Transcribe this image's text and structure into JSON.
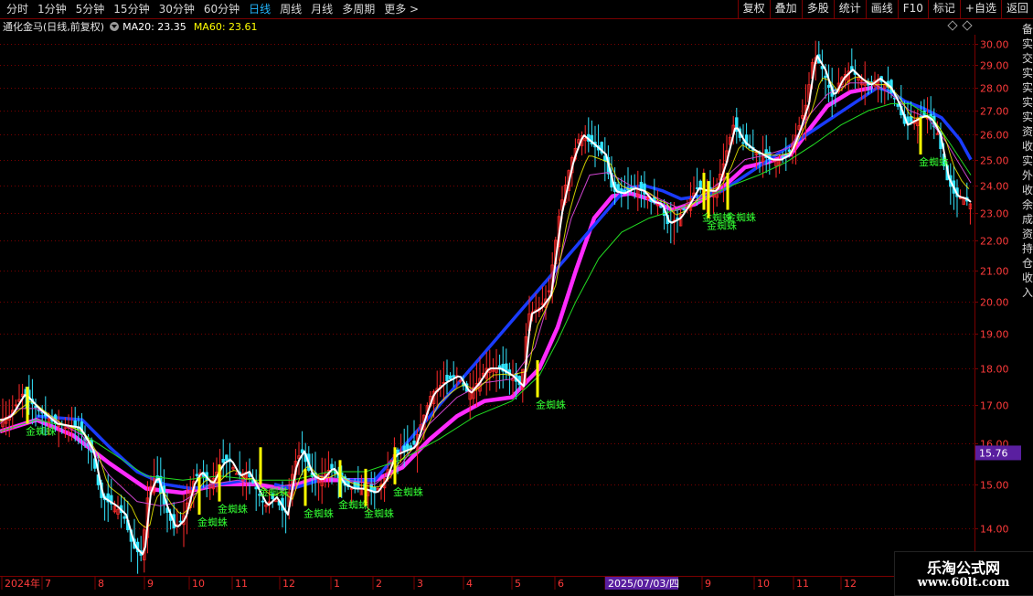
{
  "toolbar": {
    "periods": [
      "分时",
      "1分钟",
      "5分钟",
      "15分钟",
      "30分钟",
      "60分钟",
      "日线",
      "周线",
      "月线",
      "多周期",
      "更多"
    ],
    "active_period": "日线",
    "more_suffix": ">",
    "buttons": [
      "复权",
      "叠加",
      "多股",
      "统计",
      "画线",
      "F10",
      "标记",
      "+自选",
      "返回"
    ]
  },
  "info": {
    "title": "通化金马(日线,前复权)",
    "ma20": "MA20: 23.35",
    "ma60": "MA60: 23.61"
  },
  "watermark": {
    "title": "乐淘公式网",
    "url": "www.60lt.com"
  },
  "side_text": "备实交实实实实资收实外收余成资持仓收入",
  "colors": {
    "background": "#000000",
    "grid": "#7a0000",
    "up": "#ff2a2a",
    "down": "#33e6ff",
    "ma_white": "#ffffff",
    "ma_yellow": "#ffff00",
    "band_magenta": "#ff2bff",
    "band_blue": "#1a3cff",
    "ma_purple": "#cc44cc",
    "ma_green": "#22dd22",
    "signal_yellow": "#ffff00",
    "signal_label": "#33ff33",
    "current_price_bg": "#5a1fa0"
  },
  "chart_data": {
    "type": "candlestick",
    "title": "",
    "y_axis": {
      "ticks": [
        14.0,
        15.0,
        16.0,
        17.0,
        18.0,
        19.0,
        20.0,
        21.0,
        22.0,
        23.0,
        24.0,
        25.0,
        26.0,
        27.0,
        28.0,
        29.0,
        30.0
      ],
      "range": [
        13.0,
        30.2
      ],
      "side": "right",
      "scale": "log"
    },
    "current_price": "15.76",
    "x_axis": {
      "labels": [
        "2024年",
        "7",
        "8",
        "9",
        "10",
        "11",
        "12",
        "1",
        "2",
        "3",
        "4",
        "5",
        "6",
        "2025/07/03/四",
        "9",
        "10",
        "11",
        "12"
      ]
    },
    "price_path": [
      [
        0,
        16.6
      ],
      [
        10,
        16.7
      ],
      [
        25,
        17.3
      ],
      [
        40,
        16.9
      ],
      [
        60,
        16.5
      ],
      [
        85,
        16.4
      ],
      [
        100,
        15.8
      ],
      [
        110,
        14.7
      ],
      [
        125,
        14.5
      ],
      [
        135,
        14.3
      ],
      [
        145,
        13.6
      ],
      [
        155,
        13.4
      ],
      [
        162,
        14.8
      ],
      [
        170,
        15.2
      ],
      [
        180,
        14.5
      ],
      [
        190,
        14.0
      ],
      [
        200,
        14.2
      ],
      [
        210,
        15.0
      ],
      [
        218,
        15.3
      ],
      [
        230,
        15.0
      ],
      [
        242,
        15.5
      ],
      [
        250,
        15.6
      ],
      [
        260,
        15.2
      ],
      [
        270,
        15.3
      ],
      [
        280,
        14.9
      ],
      [
        290,
        14.5
      ],
      [
        300,
        14.7
      ],
      [
        312,
        14.3
      ],
      [
        322,
        15.5
      ],
      [
        330,
        15.8
      ],
      [
        340,
        15.2
      ],
      [
        350,
        15.1
      ],
      [
        362,
        15.4
      ],
      [
        375,
        15.0
      ],
      [
        385,
        14.9
      ],
      [
        395,
        14.9
      ],
      [
        410,
        14.8
      ],
      [
        420,
        15.1
      ],
      [
        430,
        15.7
      ],
      [
        440,
        15.8
      ],
      [
        452,
        15.9
      ],
      [
        462,
        16.6
      ],
      [
        472,
        17.3
      ],
      [
        485,
        17.6
      ],
      [
        500,
        17.8
      ],
      [
        512,
        17.3
      ],
      [
        522,
        17.6
      ],
      [
        532,
        18.0
      ],
      [
        545,
        18.0
      ],
      [
        558,
        17.8
      ],
      [
        570,
        17.5
      ],
      [
        578,
        19.6
      ],
      [
        590,
        19.8
      ],
      [
        600,
        20.2
      ],
      [
        612,
        23.0
      ],
      [
        625,
        25.0
      ],
      [
        635,
        26.0
      ],
      [
        648,
        25.6
      ],
      [
        660,
        25.2
      ],
      [
        670,
        23.8
      ],
      [
        680,
        23.7
      ],
      [
        692,
        23.9
      ],
      [
        702,
        23.8
      ],
      [
        712,
        23.4
      ],
      [
        722,
        23.3
      ],
      [
        730,
        22.6
      ],
      [
        742,
        22.8
      ],
      [
        752,
        23.3
      ],
      [
        762,
        23.9
      ],
      [
        772,
        23.8
      ],
      [
        782,
        23.8
      ],
      [
        792,
        24.9
      ],
      [
        802,
        26.4
      ],
      [
        812,
        25.7
      ],
      [
        822,
        25.4
      ],
      [
        832,
        25.2
      ],
      [
        842,
        25.0
      ],
      [
        852,
        25.0
      ],
      [
        862,
        25.2
      ],
      [
        872,
        26.1
      ],
      [
        882,
        27.3
      ],
      [
        890,
        29.5
      ],
      [
        900,
        28.8
      ],
      [
        910,
        27.6
      ],
      [
        920,
        28.4
      ],
      [
        930,
        28.8
      ],
      [
        940,
        28.4
      ],
      [
        950,
        28.1
      ],
      [
        960,
        28.4
      ],
      [
        972,
        28.0
      ],
      [
        980,
        27.4
      ],
      [
        990,
        26.4
      ],
      [
        1000,
        26.6
      ],
      [
        1010,
        26.8
      ],
      [
        1018,
        26.6
      ],
      [
        1026,
        26.0
      ],
      [
        1035,
        24.3
      ],
      [
        1045,
        23.6
      ],
      [
        1055,
        23.5
      ],
      [
        1062,
        23.3
      ]
    ],
    "series": [
      {
        "name": "MA20",
        "points": [
          [
            0,
            16.5
          ],
          [
            20,
            16.9
          ],
          [
            40,
            16.9
          ],
          [
            60,
            16.6
          ],
          [
            90,
            16.2
          ],
          [
            120,
            15.2
          ],
          [
            150,
            14.6
          ],
          [
            175,
            14.5
          ],
          [
            200,
            14.6
          ],
          [
            230,
            15.0
          ],
          [
            260,
            15.1
          ],
          [
            290,
            14.9
          ],
          [
            320,
            15.0
          ],
          [
            350,
            15.2
          ],
          [
            380,
            15.1
          ],
          [
            410,
            15.0
          ],
          [
            440,
            15.5
          ],
          [
            470,
            16.5
          ],
          [
            500,
            17.2
          ],
          [
            530,
            17.6
          ],
          [
            560,
            17.7
          ],
          [
            585,
            18.6
          ],
          [
            605,
            20.5
          ],
          [
            625,
            22.8
          ],
          [
            645,
            24.4
          ],
          [
            665,
            24.5
          ],
          [
            690,
            24.0
          ],
          [
            715,
            23.6
          ],
          [
            740,
            23.2
          ],
          [
            765,
            23.5
          ],
          [
            790,
            24.2
          ],
          [
            815,
            25.0
          ],
          [
            840,
            25.2
          ],
          [
            865,
            25.5
          ],
          [
            885,
            26.8
          ],
          [
            905,
            27.7
          ],
          [
            930,
            28.2
          ],
          [
            955,
            28.2
          ],
          [
            975,
            27.7
          ],
          [
            995,
            27.0
          ],
          [
            1015,
            26.7
          ],
          [
            1035,
            25.7
          ],
          [
            1062,
            24.1
          ]
        ]
      },
      {
        "name": "MA60",
        "points": [
          [
            0,
            16.3
          ],
          [
            40,
            16.6
          ],
          [
            80,
            16.4
          ],
          [
            120,
            15.8
          ],
          [
            160,
            15.2
          ],
          [
            200,
            15.1
          ],
          [
            240,
            15.2
          ],
          [
            280,
            15.1
          ],
          [
            320,
            15.1
          ],
          [
            360,
            15.3
          ],
          [
            400,
            15.3
          ],
          [
            440,
            15.6
          ],
          [
            480,
            16.1
          ],
          [
            520,
            16.7
          ],
          [
            560,
            17.1
          ],
          [
            590,
            17.8
          ],
          [
            610,
            18.8
          ],
          [
            630,
            20.0
          ],
          [
            655,
            21.4
          ],
          [
            680,
            22.3
          ],
          [
            710,
            22.8
          ],
          [
            740,
            23.1
          ],
          [
            770,
            23.5
          ],
          [
            800,
            24.0
          ],
          [
            830,
            24.4
          ],
          [
            860,
            24.9
          ],
          [
            890,
            25.6
          ],
          [
            920,
            26.4
          ],
          [
            950,
            27.0
          ],
          [
            975,
            27.3
          ],
          [
            995,
            27.3
          ],
          [
            1020,
            26.7
          ],
          [
            1040,
            25.6
          ],
          [
            1062,
            24.4
          ]
        ]
      },
      {
        "name": "band_lower",
        "points": [
          [
            0,
            16.3
          ],
          [
            40,
            16.6
          ],
          [
            80,
            16.2
          ],
          [
            120,
            15.5
          ],
          [
            160,
            14.9
          ],
          [
            200,
            14.8
          ],
          [
            240,
            15.0
          ],
          [
            280,
            15.0
          ],
          [
            310,
            14.9
          ],
          [
            340,
            15.1
          ],
          [
            380,
            15.1
          ],
          [
            410,
            15.1
          ],
          [
            440,
            15.4
          ],
          [
            470,
            16.1
          ],
          [
            500,
            16.7
          ],
          [
            530,
            17.1
          ],
          [
            560,
            17.2
          ],
          [
            590,
            18.0
          ],
          [
            610,
            19.2
          ],
          [
            630,
            21.0
          ],
          [
            650,
            22.8
          ],
          [
            670,
            23.6
          ],
          [
            690,
            23.7
          ],
          [
            710,
            23.5
          ],
          [
            735,
            23.1
          ],
          [
            760,
            23.3
          ],
          [
            790,
            23.9
          ],
          [
            815,
            24.7
          ],
          [
            840,
            24.9
          ],
          [
            865,
            25.2
          ],
          [
            885,
            26.2
          ],
          [
            905,
            27.2
          ],
          [
            930,
            27.8
          ],
          [
            955,
            28.0
          ]
        ]
      },
      {
        "name": "band_upper",
        "points": [
          [
            40,
            16.7
          ],
          [
            90,
            16.6
          ],
          [
            120,
            15.9
          ],
          [
            150,
            15.3
          ],
          [
            180,
            15.0
          ],
          [
            210,
            14.9
          ],
          [
            240,
            15.0
          ],
          [
            270,
            15.1
          ],
          [
            300,
            15.0
          ],
          [
            320,
            14.9
          ],
          [
            350,
            15.1
          ],
          [
            380,
            15.1
          ],
          [
            410,
            15.1
          ],
          [
            685,
            23.9
          ],
          [
            705,
            24.0
          ],
          [
            725,
            23.8
          ],
          [
            745,
            23.5
          ],
          [
            765,
            23.6
          ],
          [
            790,
            23.8
          ],
          [
            960,
            28.0
          ],
          [
            975,
            27.8
          ],
          [
            990,
            27.4
          ],
          [
            1010,
            27.1
          ],
          [
            1030,
            26.7
          ],
          [
            1050,
            25.8
          ],
          [
            1062,
            25.0
          ]
        ]
      }
    ],
    "signals": [
      {
        "x": 30,
        "price": 16.5,
        "label": "金蜘蛛"
      },
      {
        "x": 218,
        "price": 14.3,
        "label": "金蜘蛛"
      },
      {
        "x": 240,
        "price": 14.6,
        "label": "金蜘蛛"
      },
      {
        "x": 285,
        "price": 15.0,
        "label": "金蜘蛛"
      },
      {
        "x": 334,
        "price": 14.5,
        "label": "金蜘蛛"
      },
      {
        "x": 372,
        "price": 14.7,
        "label": "金蜘蛛"
      },
      {
        "x": 400,
        "price": 14.5,
        "label": "金蜘蛛"
      },
      {
        "x": 432,
        "price": 15.0,
        "label": "金蜘蛛"
      },
      {
        "x": 588,
        "price": 17.2,
        "label": "金蜘蛛"
      },
      {
        "x": 770,
        "price": 23.1,
        "label": "金蜘蛛"
      },
      {
        "x": 775,
        "price": 22.8,
        "label": "金蜘蛛"
      },
      {
        "x": 796,
        "price": 23.1,
        "label": "金蜘蛛"
      },
      {
        "x": 1007,
        "price": 25.2,
        "label": "金蜘蛛"
      }
    ],
    "legend": "none",
    "grid": true
  }
}
